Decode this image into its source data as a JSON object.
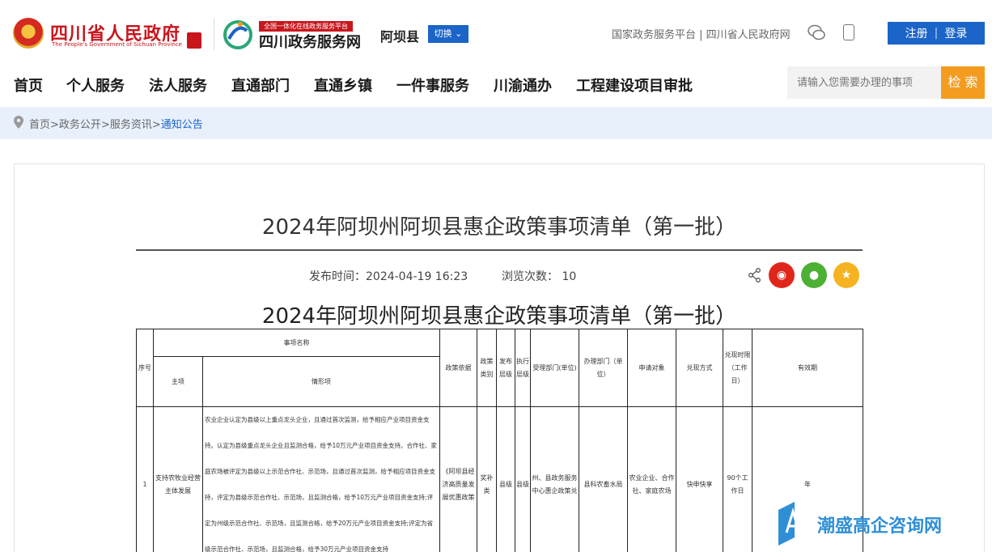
{
  "header": {
    "gov_title": "四川省人民政府",
    "gov_subtitle": "The People's Government of Sichuan Province",
    "platform_tag": "全国一体化在线政务服务平台",
    "platform_title": "四川政务服务网",
    "county": "阿坝县",
    "switch_label": "切换",
    "top_links": "国家政务服务平台 | 四川省人民政府网",
    "register_label": "注册",
    "login_label": "登录"
  },
  "nav": {
    "items": [
      "首页",
      "个人服务",
      "法人服务",
      "直通部门",
      "直通乡镇",
      "一件事服务",
      "川渝通办",
      "工程建设项目审批"
    ],
    "search_placeholder": "请输入您需要办理的事项",
    "search_button": "检 索"
  },
  "breadcrumb": {
    "items": [
      "首页",
      "政务公开",
      "服务资讯"
    ],
    "current": "通知公告",
    "sep": ">"
  },
  "article": {
    "title": "2024年阿坝州阿坝县惠企政策事项清单（第一批）",
    "publish_label": "发布时间：",
    "publish_time": "2024-04-19 16:23",
    "views_label": "浏览次数：",
    "views": "10",
    "doc_title": "2024年阿坝州阿坝县惠企政策事项清单（第一批）"
  },
  "table": {
    "headers": {
      "index": "序号",
      "item_name": "事项名称",
      "main_item": "主项",
      "scenario": "情形项",
      "basis": "政策依据",
      "category": "政策类别",
      "issue_level": "发布层级",
      "exec_level": "执行层级",
      "accept_dept": "受理部门(单位)",
      "handle_dept": "办理部门（单位）",
      "applicant": "申请对象",
      "method": "兑现方式",
      "time_limit": "兑现时限（工作日）",
      "validity": "有效期"
    },
    "row1": {
      "index": "1",
      "main_item": "支持农牧业经营主体发展",
      "scenario": "农业企业认定为县级以上重点龙头企业，且通过首次监测，给予相应产业项目资金支持。认定为县级重点龙头企业且监测合格，给予10万元产业项目资金支持。合作社、家庭农场被评定为县级以上示范合作社、示范场，且通过首次监测，给予相应项目资金支持，评定为县级示范合作社、示范场，且监测合格，给予10万元产业项目资金支持;评定为州级示范合作社、示范场，且监测合格，给予20万元产业项目资金支持;评定为省级示范合作社、示范场，且监测合格，给予30万元产业项目资金支持",
      "basis": "《阿坝县经济高质量发展优惠政策",
      "category": "奖补类",
      "issue_level": "县级",
      "exec_level": "县级",
      "accept_dept": "州、县政务服务中心惠企政策兑",
      "handle_dept": "县科农畜水局",
      "applicant": "农业企业、合作社、家庭农场",
      "method": "快申快享",
      "time_limit": "90个工作日",
      "validity": "年"
    }
  },
  "watermark": {
    "text": "潮盛高企咨询网"
  },
  "colors": {
    "gov_red": "#c8161d",
    "brand_blue": "#1b64c8",
    "search_orange": "#f39c1f",
    "weibo_red": "#e0261b",
    "wechat_green": "#4cb035",
    "favorite_gold": "#f5b321",
    "breadcrumb_bg": "#e8f0fb"
  },
  "icons": {
    "share": "share-icon",
    "weibo": "weibo-icon",
    "wechat": "wechat-icon",
    "favorite": "star-icon"
  }
}
